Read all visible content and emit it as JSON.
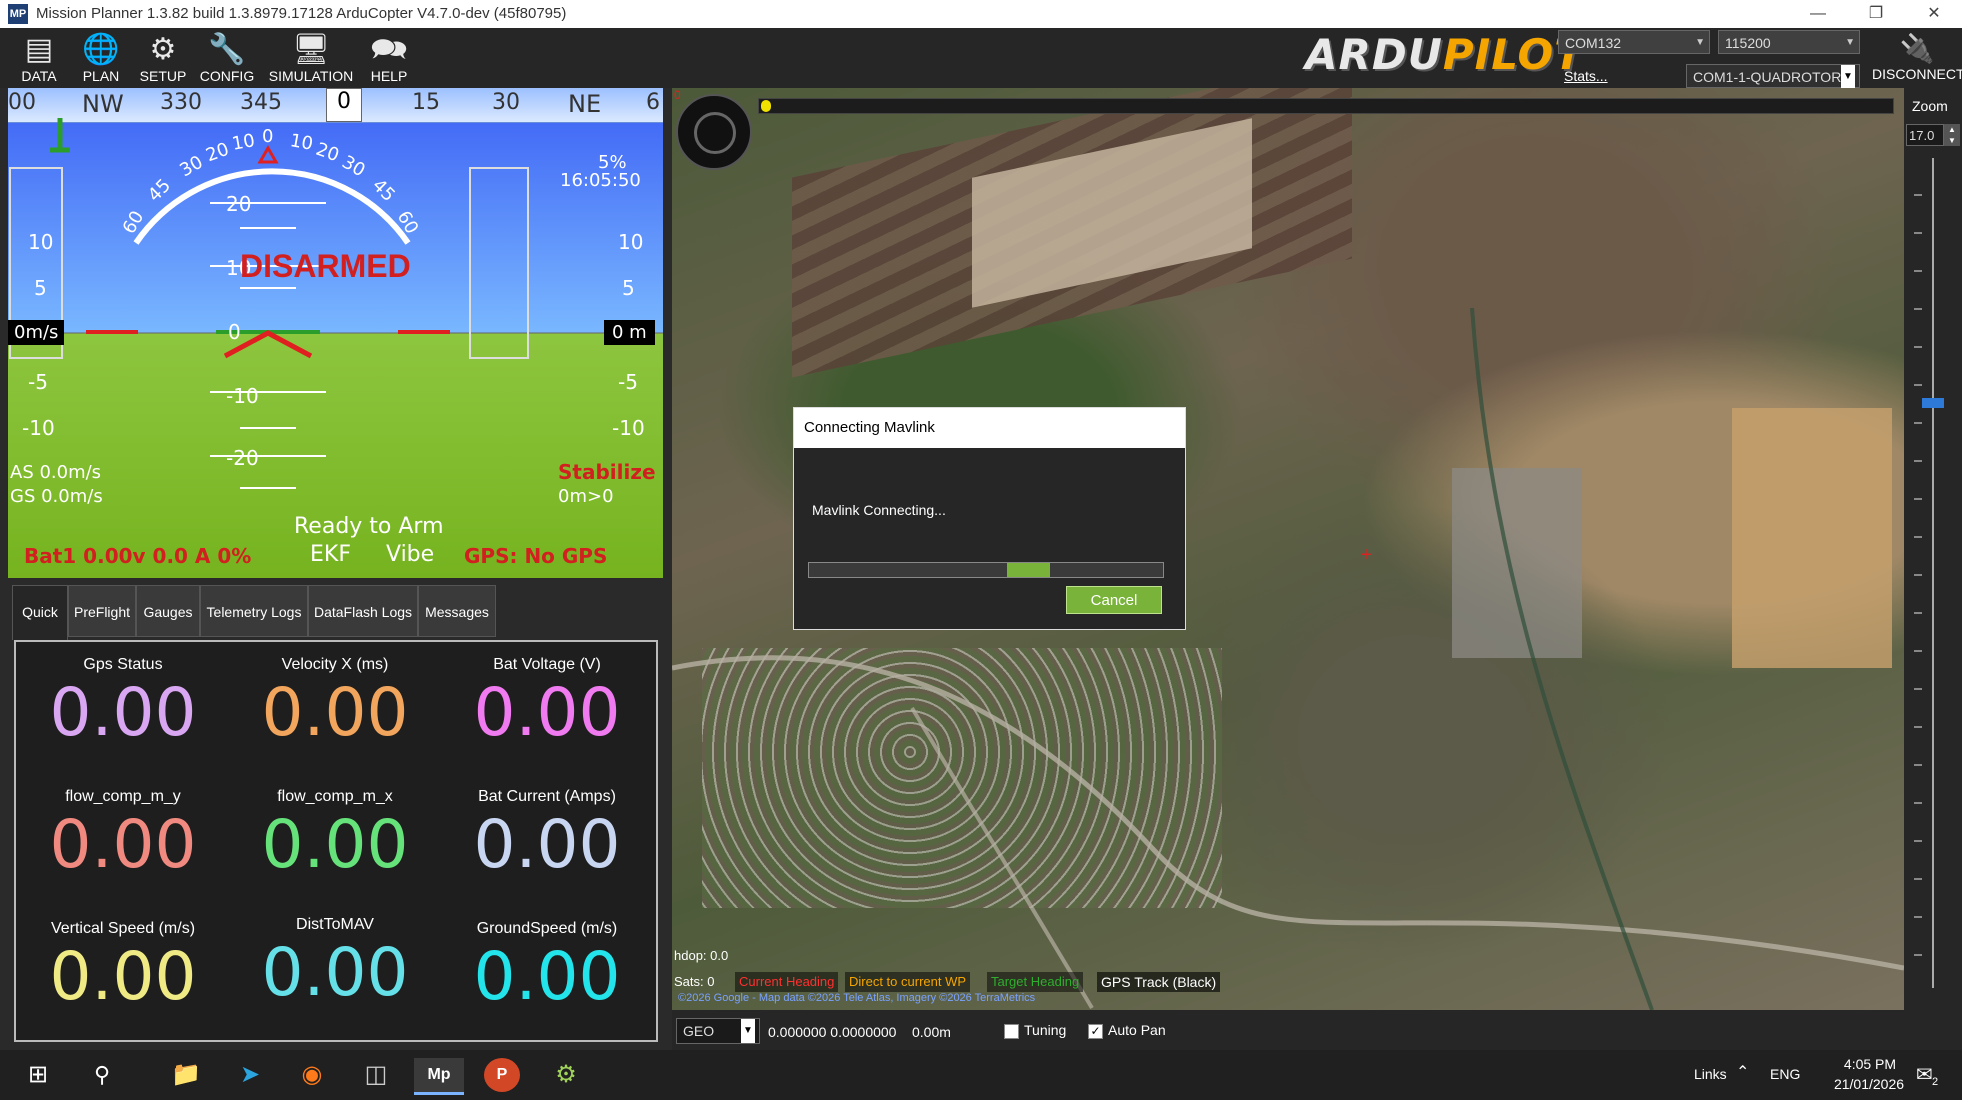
{
  "window": {
    "title": "Mission Planner 1.3.82 build 1.3.8979.17128 ArduCopter V4.7.0-dev (45f80795)",
    "app_icon": "MP"
  },
  "toolbar": {
    "buttons": [
      {
        "label": "DATA",
        "icon": "data-icon"
      },
      {
        "label": "PLAN",
        "icon": "globe-icon"
      },
      {
        "label": "SETUP",
        "icon": "gear-icon"
      },
      {
        "label": "CONFIG",
        "icon": "wrench-icon"
      },
      {
        "label": "SIMULATION",
        "icon": "monitor-icon"
      },
      {
        "label": "HELP",
        "icon": "help-icon"
      }
    ],
    "logo": {
      "part1": "ARDU",
      "part2": "PILOT"
    },
    "com_port": "COM132",
    "baud": "115200",
    "stats_link": "Stats...",
    "vehicle": "COM1-1-QUADROTOR",
    "disconnect": "DISCONNECT"
  },
  "hud": {
    "compass_ticks": [
      "00",
      "NW",
      "330",
      "345",
      "0",
      "15",
      "30",
      "NE",
      "6"
    ],
    "roll_labels": [
      "60",
      "45",
      "30",
      "20",
      "10",
      "0",
      "10",
      "20",
      "30",
      "45",
      "60"
    ],
    "pitch_labels": [
      "20",
      "10",
      "0",
      "-10",
      "-20"
    ],
    "left_tape": [
      "10",
      "5",
      "0m/s",
      "-5",
      "-10"
    ],
    "right_tape": [
      "10",
      "5",
      "0 m",
      "-5",
      "-10"
    ],
    "armed_state": "DISARMED",
    "throttle_pct": "5%",
    "time": "16:05:50",
    "airspeed": "AS 0.0m/s",
    "groundspeed": "GS 0.0m/s",
    "mode": "Stabilize",
    "wp_dist": "0m>0",
    "ready": "Ready to Arm",
    "ekf": "EKF",
    "vibe": "Vibe",
    "battery": "Bat1 0.00v 0.0 A 0%",
    "gps": "GPS: No GPS"
  },
  "tabs": [
    {
      "label": "Quick",
      "active": true
    },
    {
      "label": "PreFlight"
    },
    {
      "label": "Gauges"
    },
    {
      "label": "Telemetry Logs"
    },
    {
      "label": "DataFlash Logs"
    },
    {
      "label": "Messages"
    }
  ],
  "quick": [
    {
      "label": "Gps Status",
      "value": "0.00",
      "color": "#d9a6f2"
    },
    {
      "label": "Velocity X (ms)",
      "value": "0.00",
      "color": "#f2a55c"
    },
    {
      "label": "Bat Voltage (V)",
      "value": "0.00",
      "color": "#f07af0"
    },
    {
      "label": "flow_comp_m_y",
      "value": "0.00",
      "color": "#f08a80"
    },
    {
      "label": "flow_comp_m_x",
      "value": "0.00",
      "color": "#66e27a"
    },
    {
      "label": "Bat Current (Amps)",
      "value": "0.00",
      "color": "#c9d6f2"
    },
    {
      "label": "Vertical Speed (m/s)",
      "value": "0.00",
      "color": "#f0ea85"
    },
    {
      "label": "DistToMAV",
      "value": "0.00",
      "color": "#66e0e8"
    },
    {
      "label": "GroundSpeed (m/s)",
      "value": "0.00",
      "color": "#22e4ea"
    }
  ],
  "map": {
    "zoom_label": "Zoom",
    "zoom_value": "17.0",
    "hdop": "hdop: 0.0",
    "sats": "Sats: 0",
    "legend": [
      "Current Heading",
      "Direct to current WP",
      "Target Heading",
      "GPS Track (Black)"
    ],
    "copyright": "©2026 Google - Map data ©2026 Tele Atlas, Imagery ©2026 TerraMetrics",
    "wind_label": "0",
    "coord_system": "GEO",
    "coords": "0.000000 0.0000000",
    "alt": "0.00m",
    "tuning_label": "Tuning",
    "tuning_checked": false,
    "autopan_label": "Auto Pan",
    "autopan_checked": true
  },
  "dialog": {
    "title": "Connecting Mavlink",
    "message": "Mavlink Connecting...",
    "progress": 0.08,
    "cancel": "Cancel"
  },
  "taskbar": {
    "links": "Links",
    "lang": "ENG",
    "time": "4:05 PM",
    "date": "21/01/2026",
    "notif_count": "2",
    "apps": [
      "start-icon",
      "search-icon",
      "folder-icon",
      "telegram-icon",
      "firefox-icon",
      "app-icon",
      "mission-planner-icon",
      "powerpoint-icon",
      "settings-icon"
    ]
  }
}
